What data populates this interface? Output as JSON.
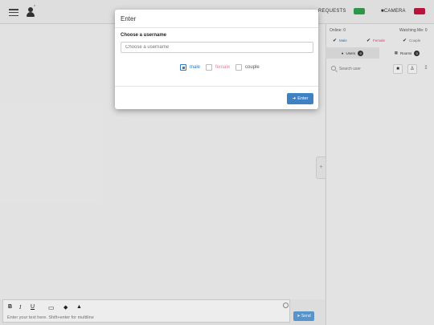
{
  "topbar": {
    "user_tag": "*",
    "requests_label": "REQUESTS",
    "camera_label": "CAMERA",
    "requests_color": "#2e9e4a",
    "camera_color": "#c0143c"
  },
  "sidebar": {
    "online": "Online: 0",
    "watching": "Watching Me: 0",
    "filters": [
      {
        "label": "Male",
        "color": "#2a7ac2"
      },
      {
        "label": "Female",
        "color": "#e0457a"
      },
      {
        "label": "Couple",
        "color": "#777777"
      }
    ],
    "tabs": [
      {
        "label": "Users",
        "count": "0"
      },
      {
        "label": "Rooms",
        "count": "0"
      }
    ],
    "search_placeholder": "Search user"
  },
  "composer": {
    "bold": "B",
    "italic": "I",
    "underline": "U",
    "placeholder": "Enter your text here. Shift+enter for multiline",
    "send_label": "Send"
  },
  "modal": {
    "title": "Enter",
    "field_label": "Choose a username",
    "username_placeholder": "Choose a username",
    "genders": [
      {
        "label": "male",
        "color": "#2a7ac2",
        "checked": true
      },
      {
        "label": "female",
        "color": "#e87ea1",
        "checked": false
      },
      {
        "label": "couple",
        "color": "#555555",
        "checked": false
      }
    ],
    "enter_label": "Enter"
  }
}
